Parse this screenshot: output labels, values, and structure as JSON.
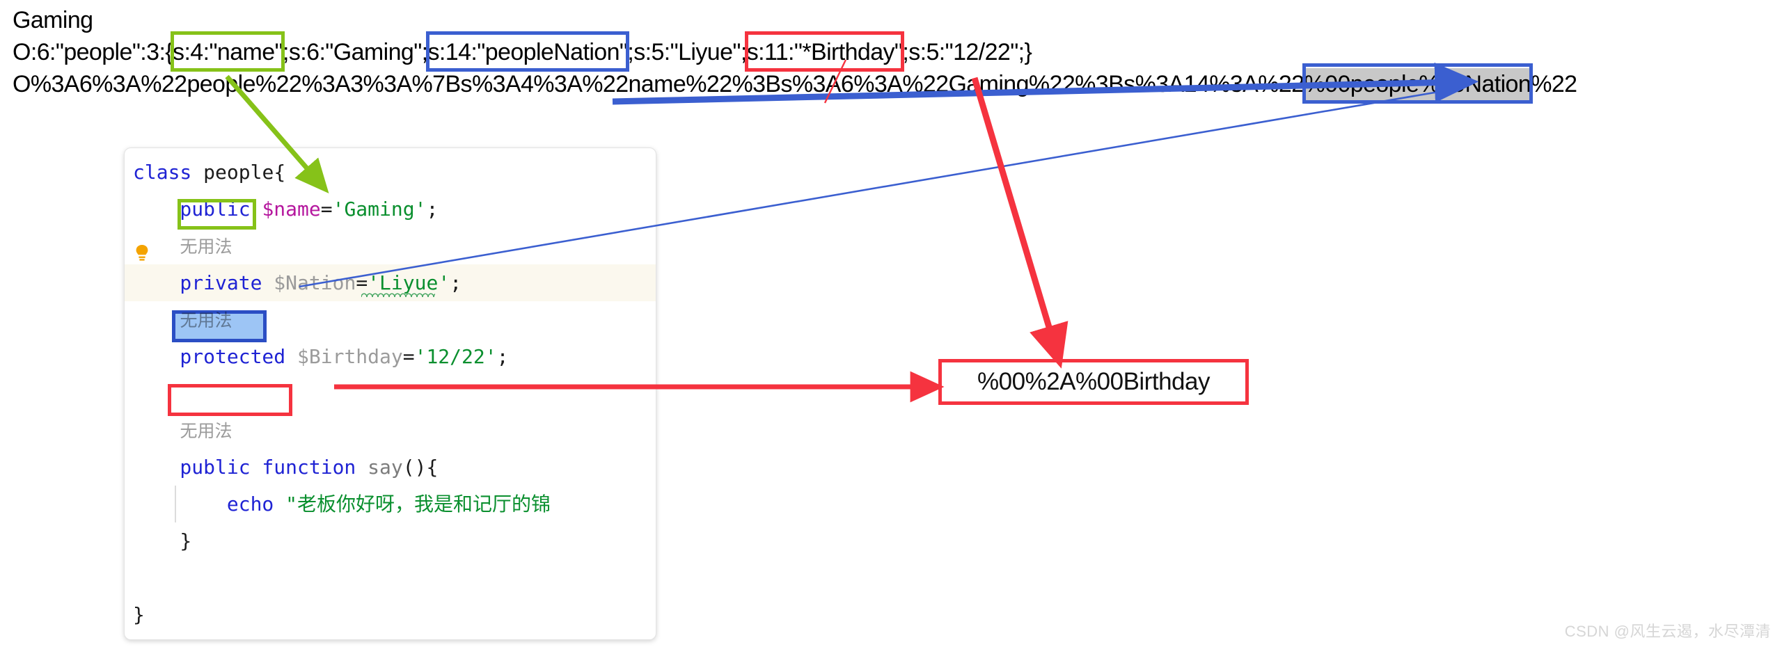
{
  "header": {
    "title": "Gaming"
  },
  "serialized": {
    "prefix": "O:6:\"people\":3:{",
    "seg_name": "s:4:\"name\"",
    "mid1": ";s:6:\"Gaming\";",
    "seg_nation": "s:14:\"peopleNation\"",
    "mid2": ";s:5:\"Liyue\";",
    "seg_birthday": "s:11:\"*Birthday\"",
    "suffix": ";s:5:\"12/22\";}"
  },
  "urlencoded": {
    "part1": "O%3A6%3A%22people%22%3A3%3A%7Bs%3A4%3A%22name%22%3Bs%3A6%3A%22Gaming%22%3Bs%3A14%3A%22",
    "highlight": "%00people%00Nation",
    "part2": "%22"
  },
  "code": {
    "lines": [
      {
        "kind": "code",
        "tokens": [
          {
            "t": "class ",
            "c": "k-kw"
          },
          {
            "t": "people",
            "c": "k-plain"
          },
          {
            "t": "{",
            "c": "k-plain"
          }
        ],
        "indent": 0
      },
      {
        "kind": "code",
        "tokens": [
          {
            "t": "    public ",
            "c": "k-kw"
          },
          {
            "t": "$name",
            "c": "k-varp"
          },
          {
            "t": "=",
            "c": "k-plain"
          },
          {
            "t": "'Gaming'",
            "c": "k-str"
          },
          {
            "t": ";",
            "c": "k-plain"
          }
        ],
        "indent": 0
      },
      {
        "kind": "hint",
        "text": "无用法"
      },
      {
        "kind": "code",
        "tokens": [
          {
            "t": "    private",
            "c": "k-kw"
          },
          {
            "t": " ",
            "c": "k-plain"
          },
          {
            "t": "$Nation",
            "c": "k-var"
          },
          {
            "t": "=",
            "c": "k-plain"
          },
          {
            "t": "'Liyue'",
            "c": "k-str"
          },
          {
            "t": ";",
            "c": "k-plain"
          }
        ],
        "indent": 0,
        "highlighted": true
      },
      {
        "kind": "hint",
        "text": "无用法"
      },
      {
        "kind": "code",
        "tokens": [
          {
            "t": "    protected",
            "c": "k-kw"
          },
          {
            "t": " ",
            "c": "k-plain"
          },
          {
            "t": "$Birthday",
            "c": "k-var"
          },
          {
            "t": "=",
            "c": "k-plain"
          },
          {
            "t": "'12/22'",
            "c": "k-str"
          },
          {
            "t": ";",
            "c": "k-plain"
          }
        ],
        "indent": 0
      },
      {
        "kind": "blank",
        "text": " "
      },
      {
        "kind": "hint",
        "text": "无用法"
      },
      {
        "kind": "code",
        "tokens": [
          {
            "t": "    public function ",
            "c": "k-kw"
          },
          {
            "t": "say",
            "c": "k-fn"
          },
          {
            "t": "(){",
            "c": "k-plain"
          }
        ],
        "indent": 0
      },
      {
        "kind": "code",
        "tokens": [
          {
            "t": "        echo ",
            "c": "k-kw"
          },
          {
            "t": "\"老板你好呀，我是和记厅的锦",
            "c": "k-str"
          }
        ],
        "indent": 1
      },
      {
        "kind": "code",
        "tokens": [
          {
            "t": "    }",
            "c": "k-plain"
          }
        ],
        "indent": 0
      },
      {
        "kind": "blank",
        "text": " "
      },
      {
        "kind": "code",
        "tokens": [
          {
            "t": "}",
            "c": "k-plain"
          }
        ],
        "indent": 0
      }
    ],
    "hint_label": "无用法",
    "bulb_icon": "lightbulb-icon"
  },
  "callout": {
    "text": "%00%2A%00Birthday"
  },
  "watermark": {
    "text": "CSDN @风生云遏，水尽潭清"
  },
  "colors": {
    "green_box": "#86c219",
    "blue_box": "#3b5fd0",
    "red_box": "#f5333f",
    "code_keyword": "#1f23d4",
    "code_string": "#0a8f2e",
    "code_var_magenta": "#b5179e",
    "code_var_grey": "#9b9b9b",
    "selection_blue": "#9dc5f5"
  }
}
